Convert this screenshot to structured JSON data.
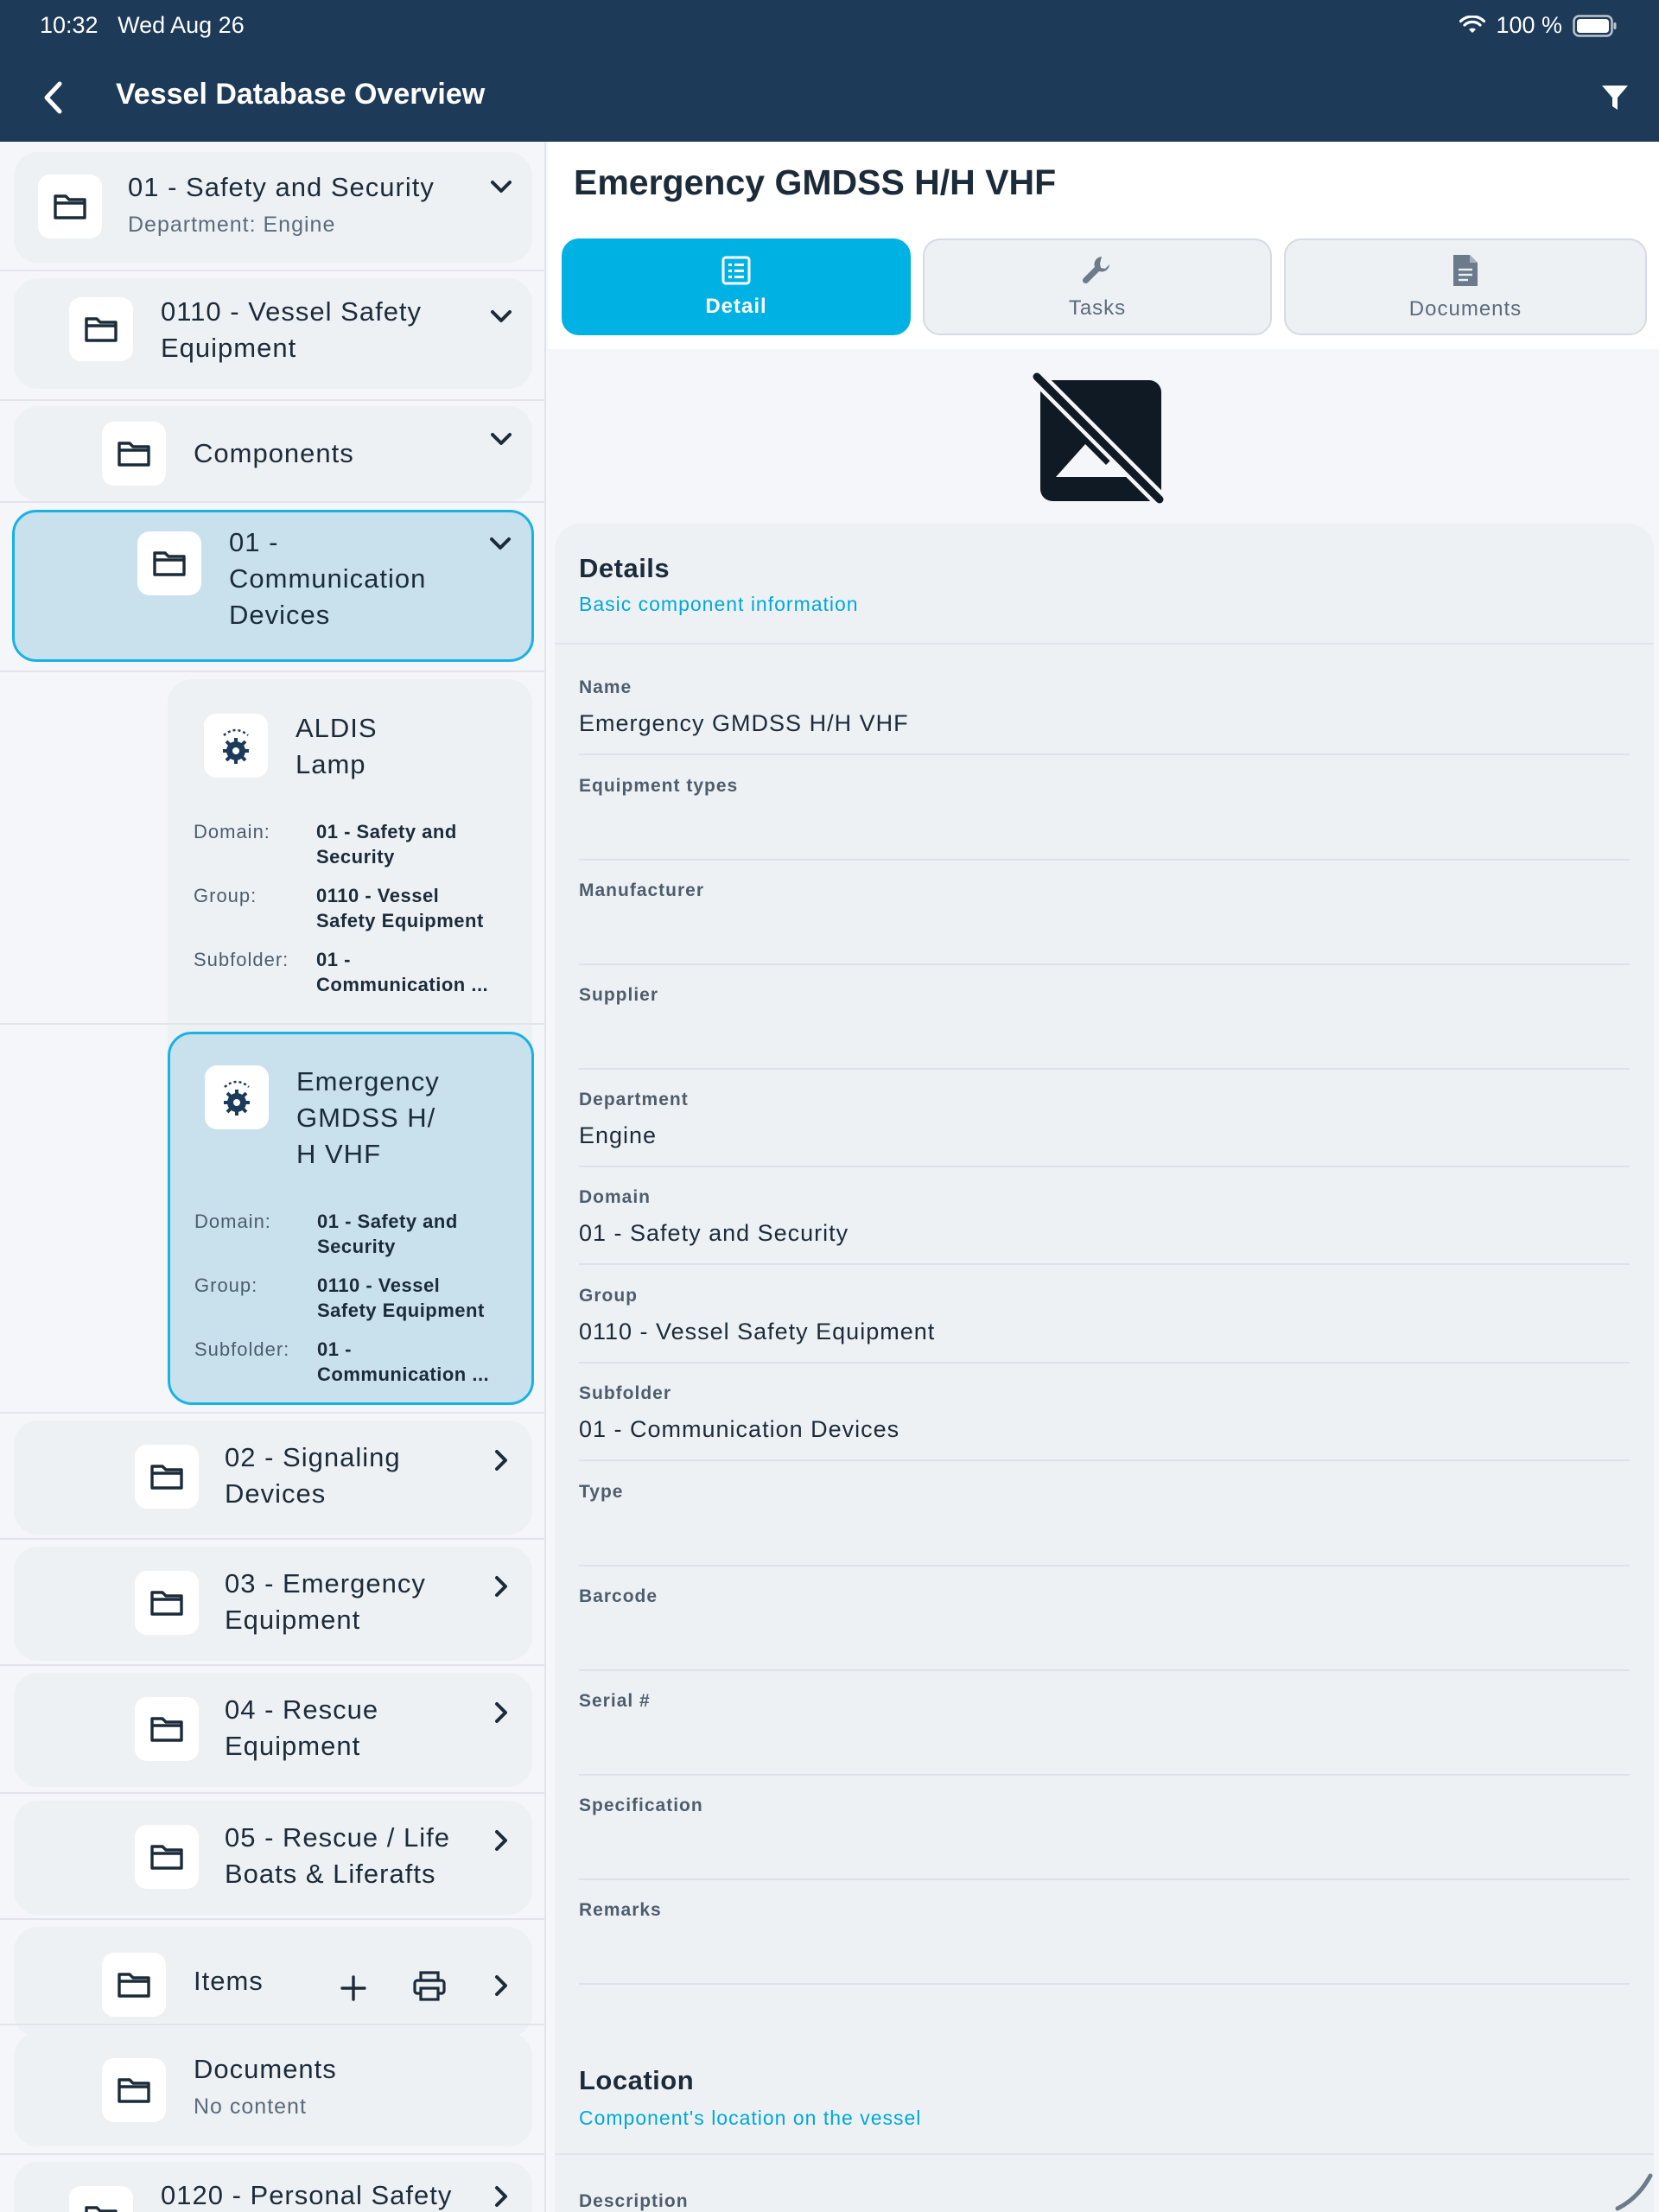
{
  "status": {
    "time": "10:32",
    "date": "Wed Aug 26",
    "battery": "100 %"
  },
  "nav": {
    "title": "Vessel Database Overview"
  },
  "tree": {
    "domain": {
      "title": "01 - Safety and Security",
      "subtitle": "Department: Engine"
    },
    "group": {
      "line1": "0110 - Vessel Safety",
      "line2": "Equipment"
    },
    "components": {
      "label": "Components"
    },
    "selected_folder": {
      "line1": "01 -",
      "line2": "Communication",
      "line3": "Devices"
    },
    "aldis": {
      "line1": "ALDIS",
      "line2": "Lamp",
      "domain_key": "Domain:",
      "domain_v1": "01 - Safety and",
      "domain_v2": "Security",
      "group_key": "Group:",
      "group_v1": "0110 - Vessel",
      "group_v2": "Safety Equipment",
      "sub_key": "Subfolder:",
      "sub_v1": "01 -",
      "sub_v2": "Communication ..."
    },
    "gmdss": {
      "line1": "Emergency",
      "line2": "GMDSS H/",
      "line3": "H VHF",
      "domain_key": "Domain:",
      "domain_v1": "01 - Safety and",
      "domain_v2": "Security",
      "group_key": "Group:",
      "group_v1": "0110 - Vessel",
      "group_v2": "Safety Equipment",
      "sub_key": "Subfolder:",
      "sub_v1": "01 -",
      "sub_v2": "Communication ..."
    },
    "signaling": {
      "line1": "02 - Signaling",
      "line2": "Devices"
    },
    "emergency": {
      "line1": "03 - Emergency",
      "line2": "Equipment"
    },
    "rescue": {
      "line1": "04 - Rescue",
      "line2": "Equipment"
    },
    "lifeboats": {
      "line1": "05 - Rescue / Life",
      "line2": "Boats & Liferafts"
    },
    "items": {
      "label": "Items"
    },
    "documents": {
      "label": "Documents",
      "subtitle": "No content"
    },
    "personal": {
      "label": "0120 - Personal Safety"
    }
  },
  "detail": {
    "title": "Emergency GMDSS H/H VHF",
    "tabs": [
      {
        "label": "Detail",
        "icon": "list-icon",
        "active": true
      },
      {
        "label": "Tasks",
        "icon": "wrench-icon",
        "active": false
      },
      {
        "label": "Documents",
        "icon": "document-icon",
        "active": false
      }
    ],
    "details_card": {
      "title": "Details",
      "subtitle": "Basic component information",
      "fields": [
        {
          "label": "Name",
          "value": "Emergency GMDSS H/H VHF"
        },
        {
          "label": "Equipment types",
          "value": ""
        },
        {
          "label": "Manufacturer",
          "value": ""
        },
        {
          "label": "Supplier",
          "value": ""
        },
        {
          "label": "Department",
          "value": "Engine"
        },
        {
          "label": "Domain",
          "value": "01 - Safety and Security"
        },
        {
          "label": "Group",
          "value": "0110 - Vessel Safety Equipment"
        },
        {
          "label": "Subfolder",
          "value": "01 - Communication Devices"
        },
        {
          "label": "Type",
          "value": ""
        },
        {
          "label": "Barcode",
          "value": ""
        },
        {
          "label": "Serial #",
          "value": ""
        },
        {
          "label": "Specification",
          "value": ""
        },
        {
          "label": "Remarks",
          "value": ""
        }
      ]
    },
    "location_card": {
      "title": "Location",
      "subtitle": "Component's location on the vessel",
      "first_field_label": "Description"
    }
  },
  "colors": {
    "nav_bg": "#1d3a58",
    "accent": "#00b2e3",
    "selected_bg": "#c8e1ed"
  }
}
